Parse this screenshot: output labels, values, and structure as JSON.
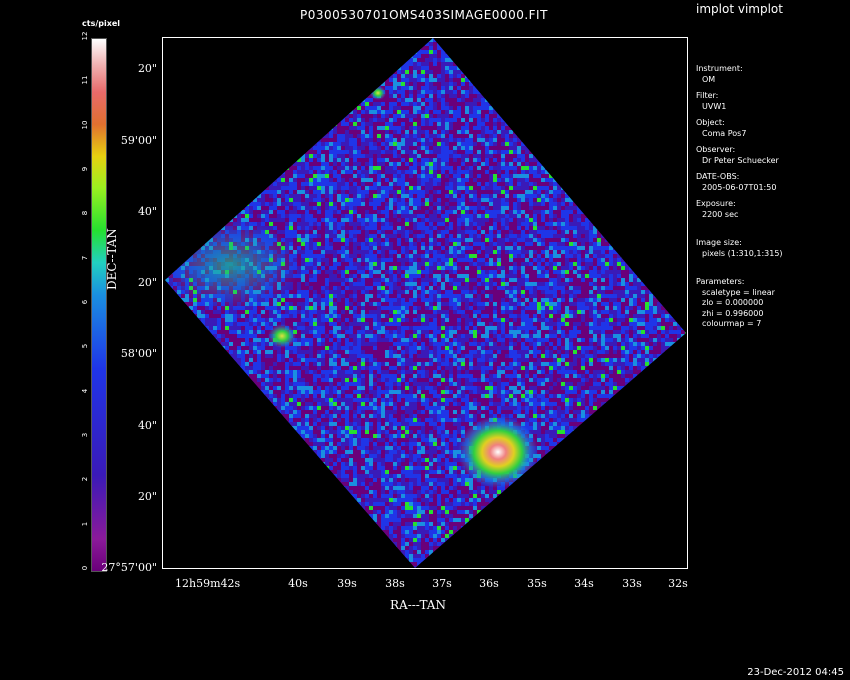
{
  "window": {
    "app_title": "implot vimplot",
    "plot_title": "P0300530701OMS403SIMAGE0000.FIT",
    "footer_date": "23-Dec-2012 04:45"
  },
  "colorbar": {
    "unit": "cts/pixel",
    "ticks": [
      "0",
      "1",
      "2",
      "3",
      "4",
      "5",
      "6",
      "7",
      "8",
      "9",
      "10",
      "11",
      "12"
    ],
    "colors": [
      "#6a007a",
      "#3a1ab8",
      "#1f35e8",
      "#1a90e0",
      "#25e030",
      "#e7d010",
      "#e86a6a",
      "#ffffff"
    ]
  },
  "axes": {
    "x_title": "RA---TAN",
    "y_title": "DEC--TAN",
    "x_ticks": [
      "12h59m42s",
      "40s",
      "39s",
      "38s",
      "37s",
      "36s",
      "35s",
      "34s",
      "33s",
      "32s"
    ],
    "y_ticks": [
      "27°57'00\"",
      "20\"",
      "40\"",
      "58'00\"",
      "20\"",
      "40\"",
      "59'00\"",
      "20\""
    ]
  },
  "info": {
    "instrument_label": "Instrument:",
    "instrument": "OM",
    "filter_label": "Filter:",
    "filter": "UVW1",
    "object_label": "Object:",
    "object": "Coma Pos7",
    "observer_label": "Observer:",
    "observer": "Dr Peter Schuecker",
    "date_label": "DATE-OBS:",
    "date": "2005-06-07T01:50",
    "exposure_label": "Exposure:",
    "exposure": "2200 sec",
    "imagesize_label": "Image size:",
    "imagesize": "pixels (1:310,1:315)",
    "params_label": "Parameters:",
    "scaletype": "scaletype = linear",
    "zlo": "zlo = 0.000000",
    "zhi": "zhi = 0.996000",
    "colourmap": "colourmap = 7"
  }
}
